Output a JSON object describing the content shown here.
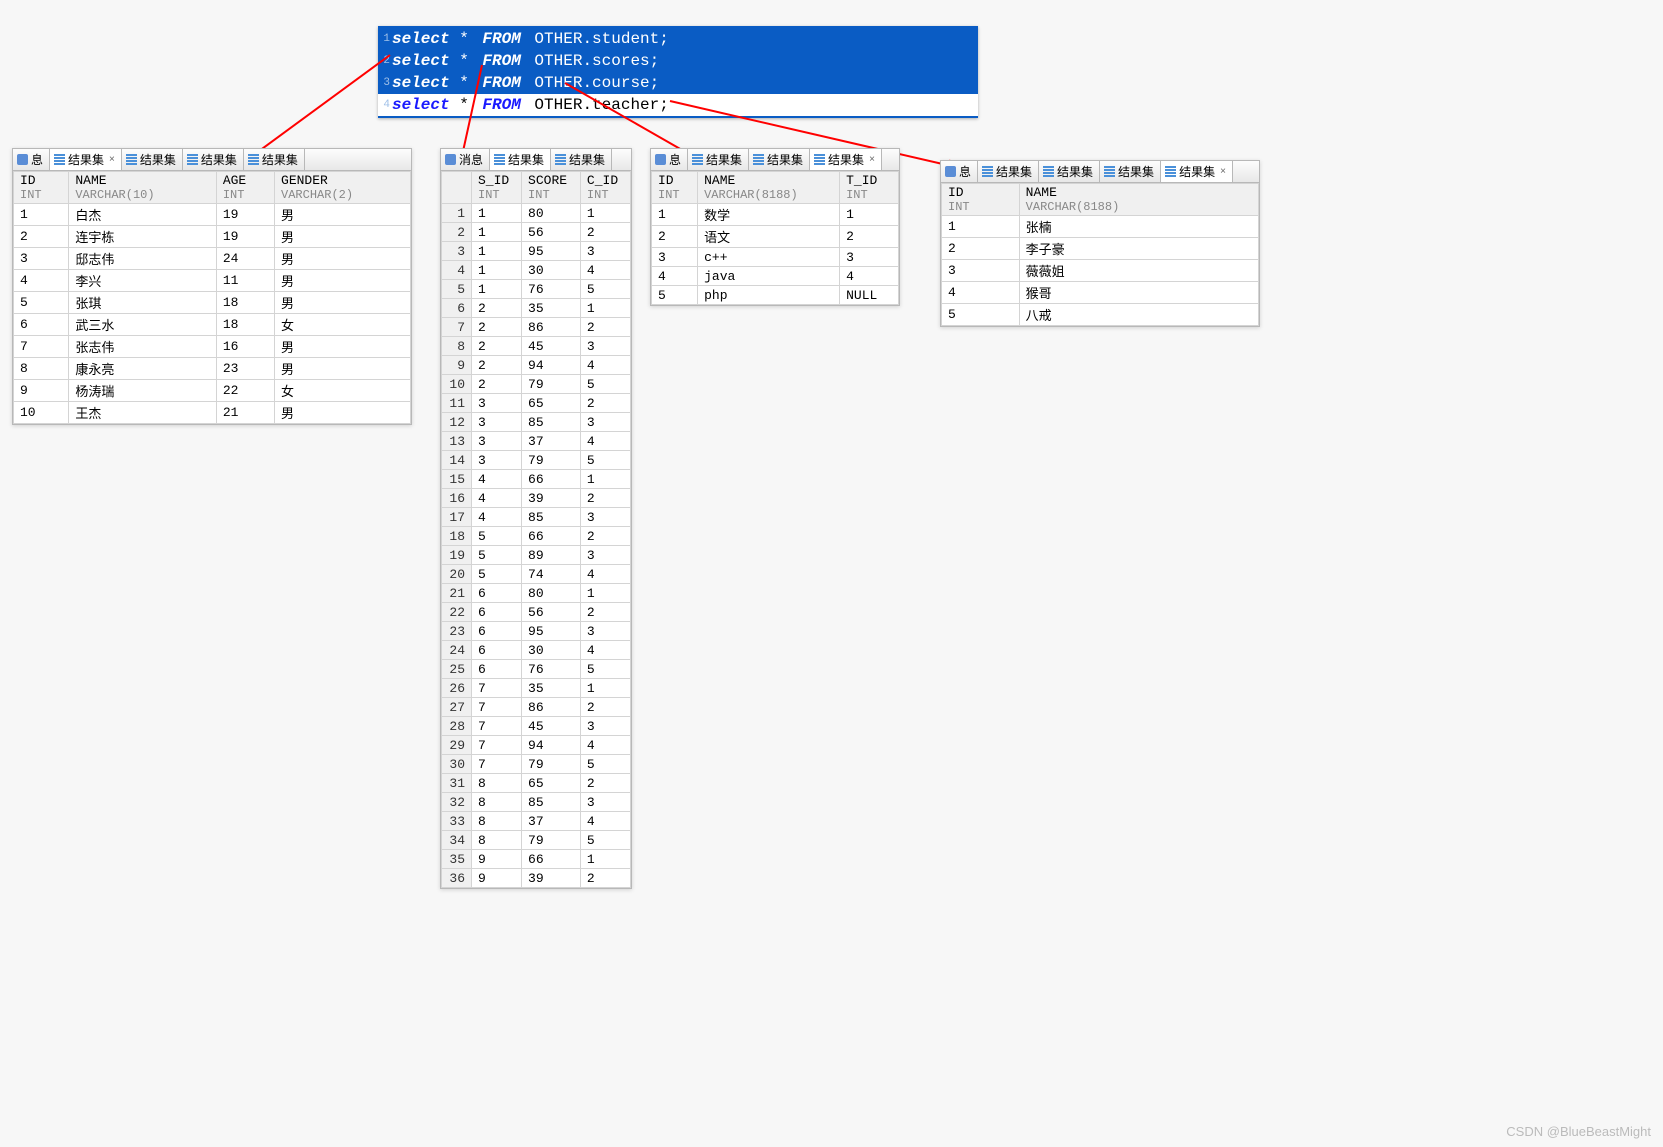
{
  "sql": {
    "lines": [
      {
        "n": "1",
        "kw1": "select",
        "star": "*",
        "kw2": "FROM",
        "rest": "OTHER.student;"
      },
      {
        "n": "2",
        "kw1": "select",
        "star": "*",
        "kw2": "FROM",
        "rest": "OTHER.scores;"
      },
      {
        "n": "3",
        "kw1": "select",
        "star": "*",
        "kw2": "FROM",
        "rest": "OTHER.course;"
      },
      {
        "n": "4",
        "kw1": "select",
        "star": "*",
        "kw2": "FROM",
        "rest": "OTHER.teacher;"
      }
    ]
  },
  "labels": {
    "msg": "消息",
    "result": "结果集",
    "x": "×"
  },
  "watermark": "CSDN @BlueBeastMight",
  "panels": {
    "student": {
      "tabs": [
        "息",
        "结果集",
        "结果集",
        "结果集",
        "结果集"
      ],
      "activeTab": 1,
      "columns": [
        {
          "name": "ID",
          "type": "INT"
        },
        {
          "name": "NAME",
          "type": "VARCHAR(10)"
        },
        {
          "name": "AGE",
          "type": "INT"
        },
        {
          "name": "GENDER",
          "type": "VARCHAR(2)"
        }
      ],
      "rows": [
        [
          "1",
          "白杰",
          "19",
          "男"
        ],
        [
          "2",
          "连宇栋",
          "19",
          "男"
        ],
        [
          "3",
          "邸志伟",
          "24",
          "男"
        ],
        [
          "4",
          "李兴",
          "11",
          "男"
        ],
        [
          "5",
          "张琪",
          "18",
          "男"
        ],
        [
          "6",
          "武三水",
          "18",
          "女"
        ],
        [
          "7",
          "张志伟",
          "16",
          "男"
        ],
        [
          "8",
          "康永亮",
          "23",
          "男"
        ],
        [
          "9",
          "杨涛瑞",
          "22",
          "女"
        ],
        [
          "10",
          "王杰",
          "21",
          "男"
        ]
      ]
    },
    "scores": {
      "tabs": [
        "消息",
        "结果集",
        "结果集"
      ],
      "activeTab": 1,
      "columns": [
        {
          "name": "S_ID",
          "type": "INT"
        },
        {
          "name": "SCORE",
          "type": "INT"
        },
        {
          "name": "C_ID",
          "type": "INT"
        }
      ],
      "rows": [
        [
          "1",
          "80",
          "1"
        ],
        [
          "1",
          "56",
          "2"
        ],
        [
          "1",
          "95",
          "3"
        ],
        [
          "1",
          "30",
          "4"
        ],
        [
          "1",
          "76",
          "5"
        ],
        [
          "2",
          "35",
          "1"
        ],
        [
          "2",
          "86",
          "2"
        ],
        [
          "2",
          "45",
          "3"
        ],
        [
          "2",
          "94",
          "4"
        ],
        [
          "2",
          "79",
          "5"
        ],
        [
          "3",
          "65",
          "2"
        ],
        [
          "3",
          "85",
          "3"
        ],
        [
          "3",
          "37",
          "4"
        ],
        [
          "3",
          "79",
          "5"
        ],
        [
          "4",
          "66",
          "1"
        ],
        [
          "4",
          "39",
          "2"
        ],
        [
          "4",
          "85",
          "3"
        ],
        [
          "5",
          "66",
          "2"
        ],
        [
          "5",
          "89",
          "3"
        ],
        [
          "5",
          "74",
          "4"
        ],
        [
          "6",
          "80",
          "1"
        ],
        [
          "6",
          "56",
          "2"
        ],
        [
          "6",
          "95",
          "3"
        ],
        [
          "6",
          "30",
          "4"
        ],
        [
          "6",
          "76",
          "5"
        ],
        [
          "7",
          "35",
          "1"
        ],
        [
          "7",
          "86",
          "2"
        ],
        [
          "7",
          "45",
          "3"
        ],
        [
          "7",
          "94",
          "4"
        ],
        [
          "7",
          "79",
          "5"
        ],
        [
          "8",
          "65",
          "2"
        ],
        [
          "8",
          "85",
          "3"
        ],
        [
          "8",
          "37",
          "4"
        ],
        [
          "8",
          "79",
          "5"
        ],
        [
          "9",
          "66",
          "1"
        ],
        [
          "9",
          "39",
          "2"
        ]
      ]
    },
    "course": {
      "tabs": [
        "息",
        "结果集",
        "结果集",
        "结果集"
      ],
      "activeTab": 3,
      "columns": [
        {
          "name": "ID",
          "type": "INT"
        },
        {
          "name": "NAME",
          "type": "VARCHAR(8188)"
        },
        {
          "name": "T_ID",
          "type": "INT"
        }
      ],
      "rows": [
        [
          "1",
          "数学",
          "1"
        ],
        [
          "2",
          "语文",
          "2"
        ],
        [
          "3",
          "c++",
          "3"
        ],
        [
          "4",
          "java",
          "4"
        ],
        [
          "5",
          "php",
          "NULL"
        ]
      ]
    },
    "teacher": {
      "tabs": [
        "息",
        "结果集",
        "结果集",
        "结果集",
        "结果集"
      ],
      "activeTab": 4,
      "columns": [
        {
          "name": "ID",
          "type": "INT"
        },
        {
          "name": "NAME",
          "type": "VARCHAR(8188)"
        }
      ],
      "rows": [
        [
          "1",
          "张楠"
        ],
        [
          "2",
          "李子豪"
        ],
        [
          "3",
          "薇薇姐"
        ],
        [
          "4",
          "猴哥"
        ],
        [
          "5",
          "八戒"
        ]
      ]
    }
  }
}
